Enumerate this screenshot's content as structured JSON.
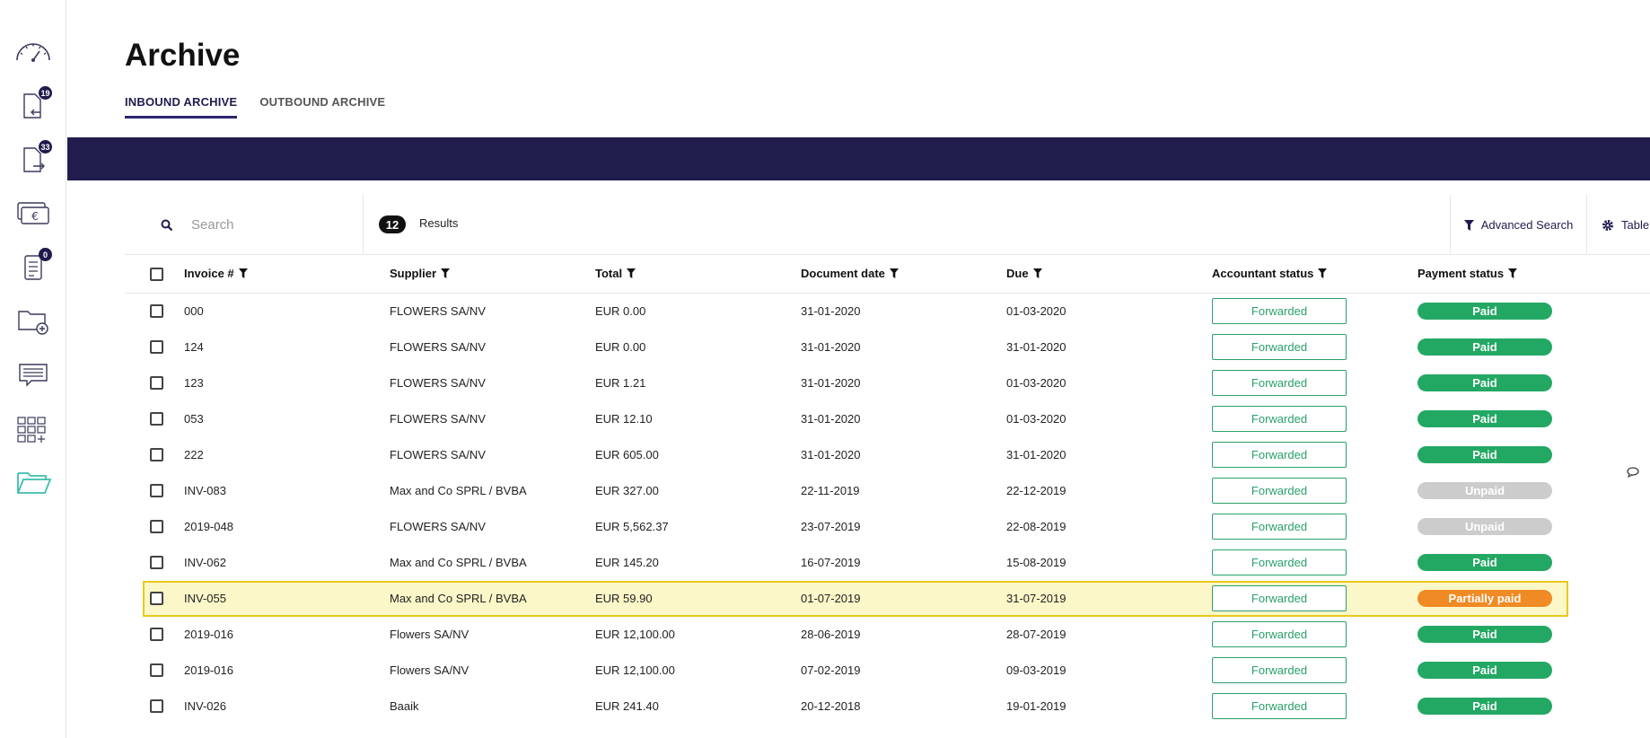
{
  "sidebar": {
    "items": [
      {
        "name": "dashboard-icon",
        "badge": null
      },
      {
        "name": "inbound-invoices-icon",
        "badge": "19"
      },
      {
        "name": "outbound-invoices-icon",
        "badge": "33"
      },
      {
        "name": "payments-icon",
        "badge": null
      },
      {
        "name": "documents-icon",
        "badge": "0"
      },
      {
        "name": "folder-add-icon",
        "badge": null
      },
      {
        "name": "messages-icon",
        "badge": null
      },
      {
        "name": "apps-grid-icon",
        "badge": null
      },
      {
        "name": "archive-folder-icon",
        "badge": null
      }
    ]
  },
  "page": {
    "title": "Archive"
  },
  "tabs": [
    {
      "label": "INBOUND ARCHIVE",
      "active": true
    },
    {
      "label": "OUTBOUND ARCHIVE",
      "active": false
    }
  ],
  "toolbar": {
    "search_placeholder": "Search",
    "result_count": "12",
    "results_label": "Results",
    "advanced_search": "Advanced Search",
    "table_options": "Table options"
  },
  "table": {
    "headers": [
      "Invoice #",
      "Supplier",
      "Total",
      "Document date",
      "Due",
      "Accountant status",
      "Payment status"
    ],
    "rows": [
      {
        "invoice": "000",
        "supplier": "FLOWERS SA/NV",
        "total": "EUR 0.00",
        "doc_date": "31-01-2020",
        "due": "01-03-2020",
        "acct": "Forwarded",
        "pay": "Paid"
      },
      {
        "invoice": "124",
        "supplier": "FLOWERS SA/NV",
        "total": "EUR 0.00",
        "doc_date": "31-01-2020",
        "due": "31-01-2020",
        "acct": "Forwarded",
        "pay": "Paid"
      },
      {
        "invoice": "123",
        "supplier": "FLOWERS SA/NV",
        "total": "EUR 1.21",
        "doc_date": "31-01-2020",
        "due": "01-03-2020",
        "acct": "Forwarded",
        "pay": "Paid"
      },
      {
        "invoice": "053",
        "supplier": "FLOWERS SA/NV",
        "total": "EUR 12.10",
        "doc_date": "31-01-2020",
        "due": "01-03-2020",
        "acct": "Forwarded",
        "pay": "Paid"
      },
      {
        "invoice": "222",
        "supplier": "FLOWERS SA/NV",
        "total": "EUR 605.00",
        "doc_date": "31-01-2020",
        "due": "31-01-2020",
        "acct": "Forwarded",
        "pay": "Paid"
      },
      {
        "invoice": "INV-083",
        "supplier": "Max and Co SPRL / BVBA",
        "total": "EUR 327.00",
        "doc_date": "22-11-2019",
        "due": "22-12-2019",
        "acct": "Forwarded",
        "pay": "Unpaid"
      },
      {
        "invoice": "2019-048",
        "supplier": "FLOWERS SA/NV",
        "total": "EUR 5,562.37",
        "doc_date": "23-07-2019",
        "due": "22-08-2019",
        "acct": "Forwarded",
        "pay": "Unpaid"
      },
      {
        "invoice": "INV-062",
        "supplier": "Max and Co SPRL / BVBA",
        "total": "EUR 145.20",
        "doc_date": "16-07-2019",
        "due": "15-08-2019",
        "acct": "Forwarded",
        "pay": "Paid"
      },
      {
        "invoice": "INV-055",
        "supplier": "Max and Co SPRL / BVBA",
        "total": "EUR 59.90",
        "doc_date": "01-07-2019",
        "due": "31-07-2019",
        "acct": "Forwarded",
        "pay": "Partially paid",
        "highlight": true
      },
      {
        "invoice": "2019-016",
        "supplier": "Flowers SA/NV",
        "total": "EUR 12,100.00",
        "doc_date": "28-06-2019",
        "due": "28-07-2019",
        "acct": "Forwarded",
        "pay": "Paid"
      },
      {
        "invoice": "2019-016",
        "supplier": "Flowers SA/NV",
        "total": "EUR 12,100.00",
        "doc_date": "07-02-2019",
        "due": "09-03-2019",
        "acct": "Forwarded",
        "pay": "Paid"
      },
      {
        "invoice": "INV-026",
        "supplier": "Baaik",
        "total": "EUR 241.40",
        "doc_date": "20-12-2018",
        "due": "19-01-2019",
        "acct": "Forwarded",
        "pay": "Paid"
      }
    ]
  },
  "colors": {
    "paid": "#23a864",
    "unpaid": "#cccccc",
    "partial": "#f08a24",
    "forwarded": "#2aa06b",
    "brand": "#201c4c"
  }
}
